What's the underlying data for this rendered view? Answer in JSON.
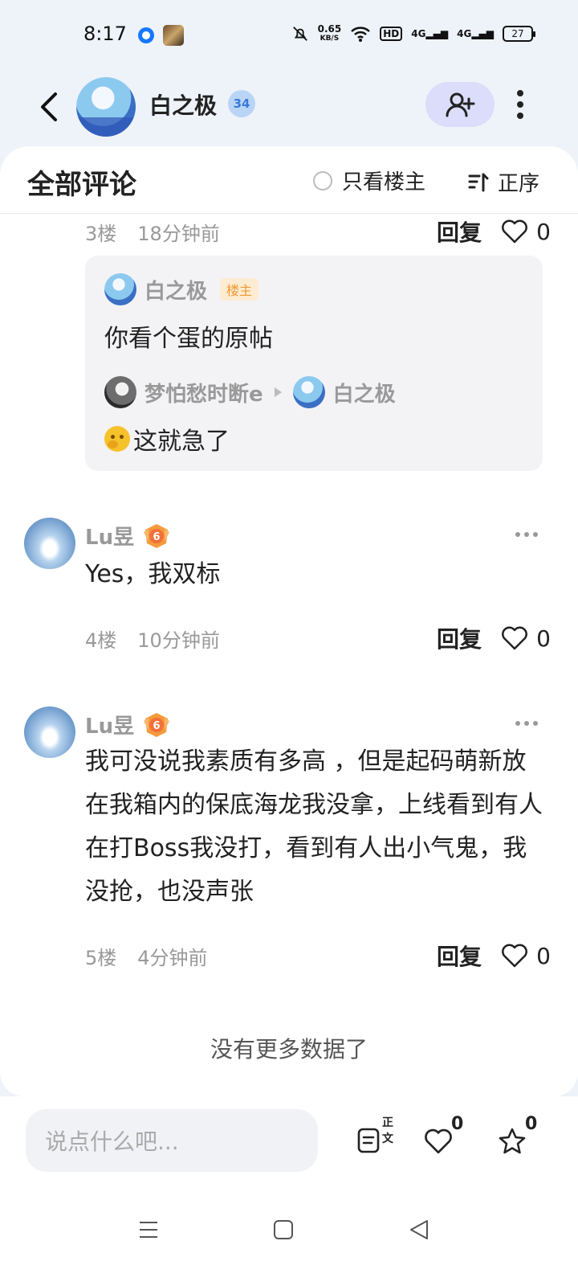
{
  "status_bar": {
    "time": "8:17",
    "net_speed_value": "0.65",
    "net_speed_unit": "KB/S",
    "hd_label": "HD",
    "sig1": "4G",
    "sig2": "4G",
    "battery": "27"
  },
  "header": {
    "name": "白之极",
    "level": "34"
  },
  "comments_panel": {
    "title": "全部评论",
    "only_op_label": "只看楼主",
    "sort_label": "正序"
  },
  "floor3": {
    "floor": "3楼",
    "time": "18分钟前",
    "reply_label": "回复",
    "likes": "0",
    "sub_replies": {
      "first": {
        "author": "白之极",
        "tag": "楼主",
        "text": "你看个蛋的原帖"
      },
      "second": {
        "author": "梦怕愁时断e",
        "reply_to": "白之极",
        "text": "这就急了"
      }
    }
  },
  "comments": [
    {
      "author": "Lu昱",
      "level": "6",
      "text": "Yes，我双标",
      "floor": "4楼",
      "time": "10分钟前",
      "reply_label": "回复",
      "likes": "0"
    },
    {
      "author": "Lu昱",
      "level": "6",
      "text": "我可没说我素质有多高 ，但是起码萌新放在我箱内的保底海龙我没拿，上线看到有人在打Boss我没打，看到有人出小气鬼，我没抢，也没声张",
      "floor": "5楼",
      "time": "4分钟前",
      "reply_label": "回复",
      "likes": "0"
    }
  ],
  "no_more_text": "没有更多数据了",
  "bottom_bar": {
    "input_placeholder": "说点什么吧...",
    "body_label": "正文",
    "like_count": "0",
    "star_count": "0"
  },
  "colors": {
    "page_bg": "#eef3fa",
    "card_bg": "#ffffff",
    "follow_btn_bg": "#dcdcfb",
    "op_tag": "#f09a2f",
    "level_badge": "#f59a3c"
  },
  "icons": [
    "back-arrow-icon",
    "add-user-icon",
    "more-vertical-icon",
    "sort-icon",
    "heart-icon",
    "more-horizontal-icon",
    "document-icon",
    "star-icon",
    "menu-icon",
    "home-square-icon",
    "back-triangle-icon"
  ]
}
